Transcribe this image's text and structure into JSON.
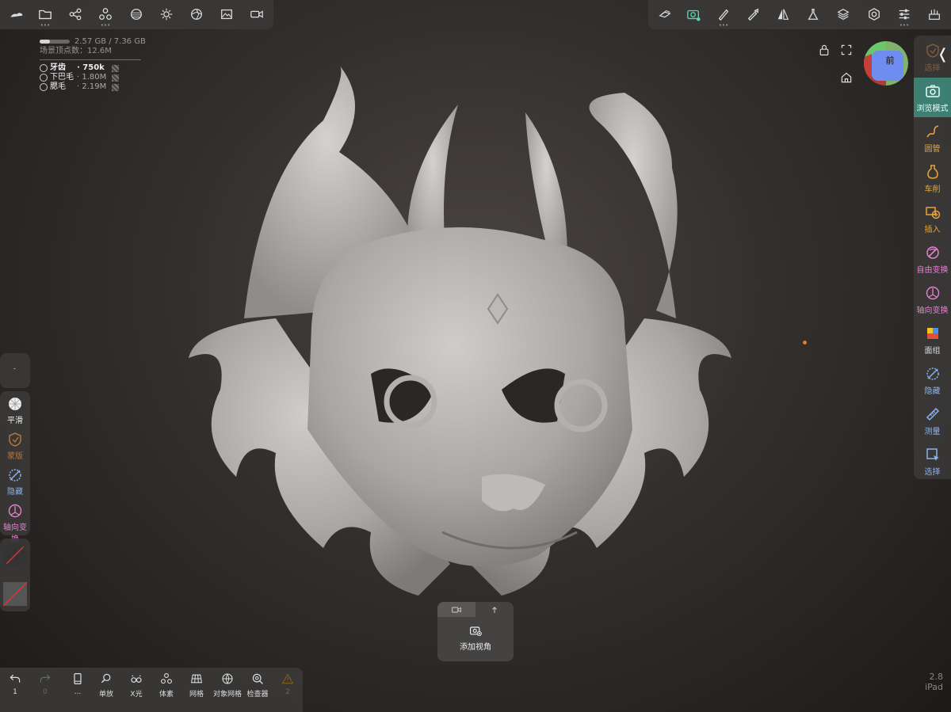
{
  "memory": {
    "usage": "2.57 GB / 7.36 GB",
    "usage_fraction": 0.35,
    "scene_vertices": "场景顶点数：12.6M"
  },
  "objects": [
    {
      "name": "牙齿",
      "count": "· 750k",
      "bold": true
    },
    {
      "name": "下巴毛",
      "count": "· 1.80M",
      "bold": false
    },
    {
      "name": "腮毛",
      "count": "· 2.19M",
      "bold": false
    }
  ],
  "top_left_tools": [
    "sculpt-icon",
    "folder-icon",
    "share-icon",
    "scene-tree-icon",
    "material-icon",
    "light-icon",
    "post-process-icon",
    "image-icon",
    "video-icon"
  ],
  "top_right_tools": [
    "stroke-icon",
    "camera-icon",
    "brush-icon",
    "paint-icon",
    "symmetry-icon",
    "flask-icon",
    "layers-icon",
    "settings-icon",
    "sliders-icon",
    "brush-settings-icon"
  ],
  "right_sidebar": [
    {
      "label": "选择",
      "icon": "mask-icon",
      "color": "#b5763d"
    },
    {
      "label": "浏览模式",
      "icon": "camera-icon",
      "color": "#e8fff9",
      "active": true
    },
    {
      "label": "圆管",
      "icon": "tube-icon",
      "color": "#e8a43a"
    },
    {
      "label": "车削",
      "icon": "lathe-icon",
      "color": "#e8a43a"
    },
    {
      "label": "插入",
      "icon": "insert-icon",
      "color": "#e8a43a"
    },
    {
      "label": "自由变换",
      "icon": "transform-icon",
      "color": "#e482d0"
    },
    {
      "label": "轴向变换",
      "icon": "axis-transform-icon",
      "color": "#e482d0"
    },
    {
      "label": "面组",
      "icon": "facegroup-icon",
      "color": "#dcdcdc"
    },
    {
      "label": "隐藏",
      "icon": "hide-icon",
      "color": "#8ab4f0"
    },
    {
      "label": "测量",
      "icon": "measure-icon",
      "color": "#8ab4f0"
    },
    {
      "label": "选择",
      "icon": "select-icon",
      "color": "#8ab4f0"
    }
  ],
  "left_sidebar": [
    {
      "label": "平滑",
      "icon": "smooth-icon",
      "color": "#eeeeee"
    },
    {
      "label": "蒙版",
      "icon": "mask-icon",
      "color": "#b5763d"
    },
    {
      "label": "隐藏",
      "icon": "hide-icon",
      "color": "#8ab4f0"
    },
    {
      "label": "轴向变换",
      "icon": "axis-transform-icon",
      "color": "#e482d0"
    }
  ],
  "bottom_tools": [
    {
      "label": "1",
      "icon": "undo-icon"
    },
    {
      "label": "0",
      "icon": "redo-icon",
      "dim": true
    },
    {
      "label": "...",
      "icon": "device-icon"
    },
    {
      "label": "单放",
      "icon": "solo-icon"
    },
    {
      "label": "X光",
      "icon": "xray-icon"
    },
    {
      "label": "体素",
      "icon": "voxel-icon"
    },
    {
      "label": "网格",
      "icon": "grid-icon"
    },
    {
      "label": "对象网格",
      "icon": "object-grid-icon"
    },
    {
      "label": "检查器",
      "icon": "inspector-icon"
    },
    {
      "label": "2",
      "icon": "warning-icon",
      "dim": true
    }
  ],
  "view_popup": {
    "add_label": "添加视角"
  },
  "gizmo": {
    "label": "前"
  },
  "version": {
    "number": "2.8",
    "device": "iPad"
  },
  "colors": {
    "accent": "#3d7f72",
    "panel": "#3a3837",
    "orange_dot": "#e07a2c"
  }
}
